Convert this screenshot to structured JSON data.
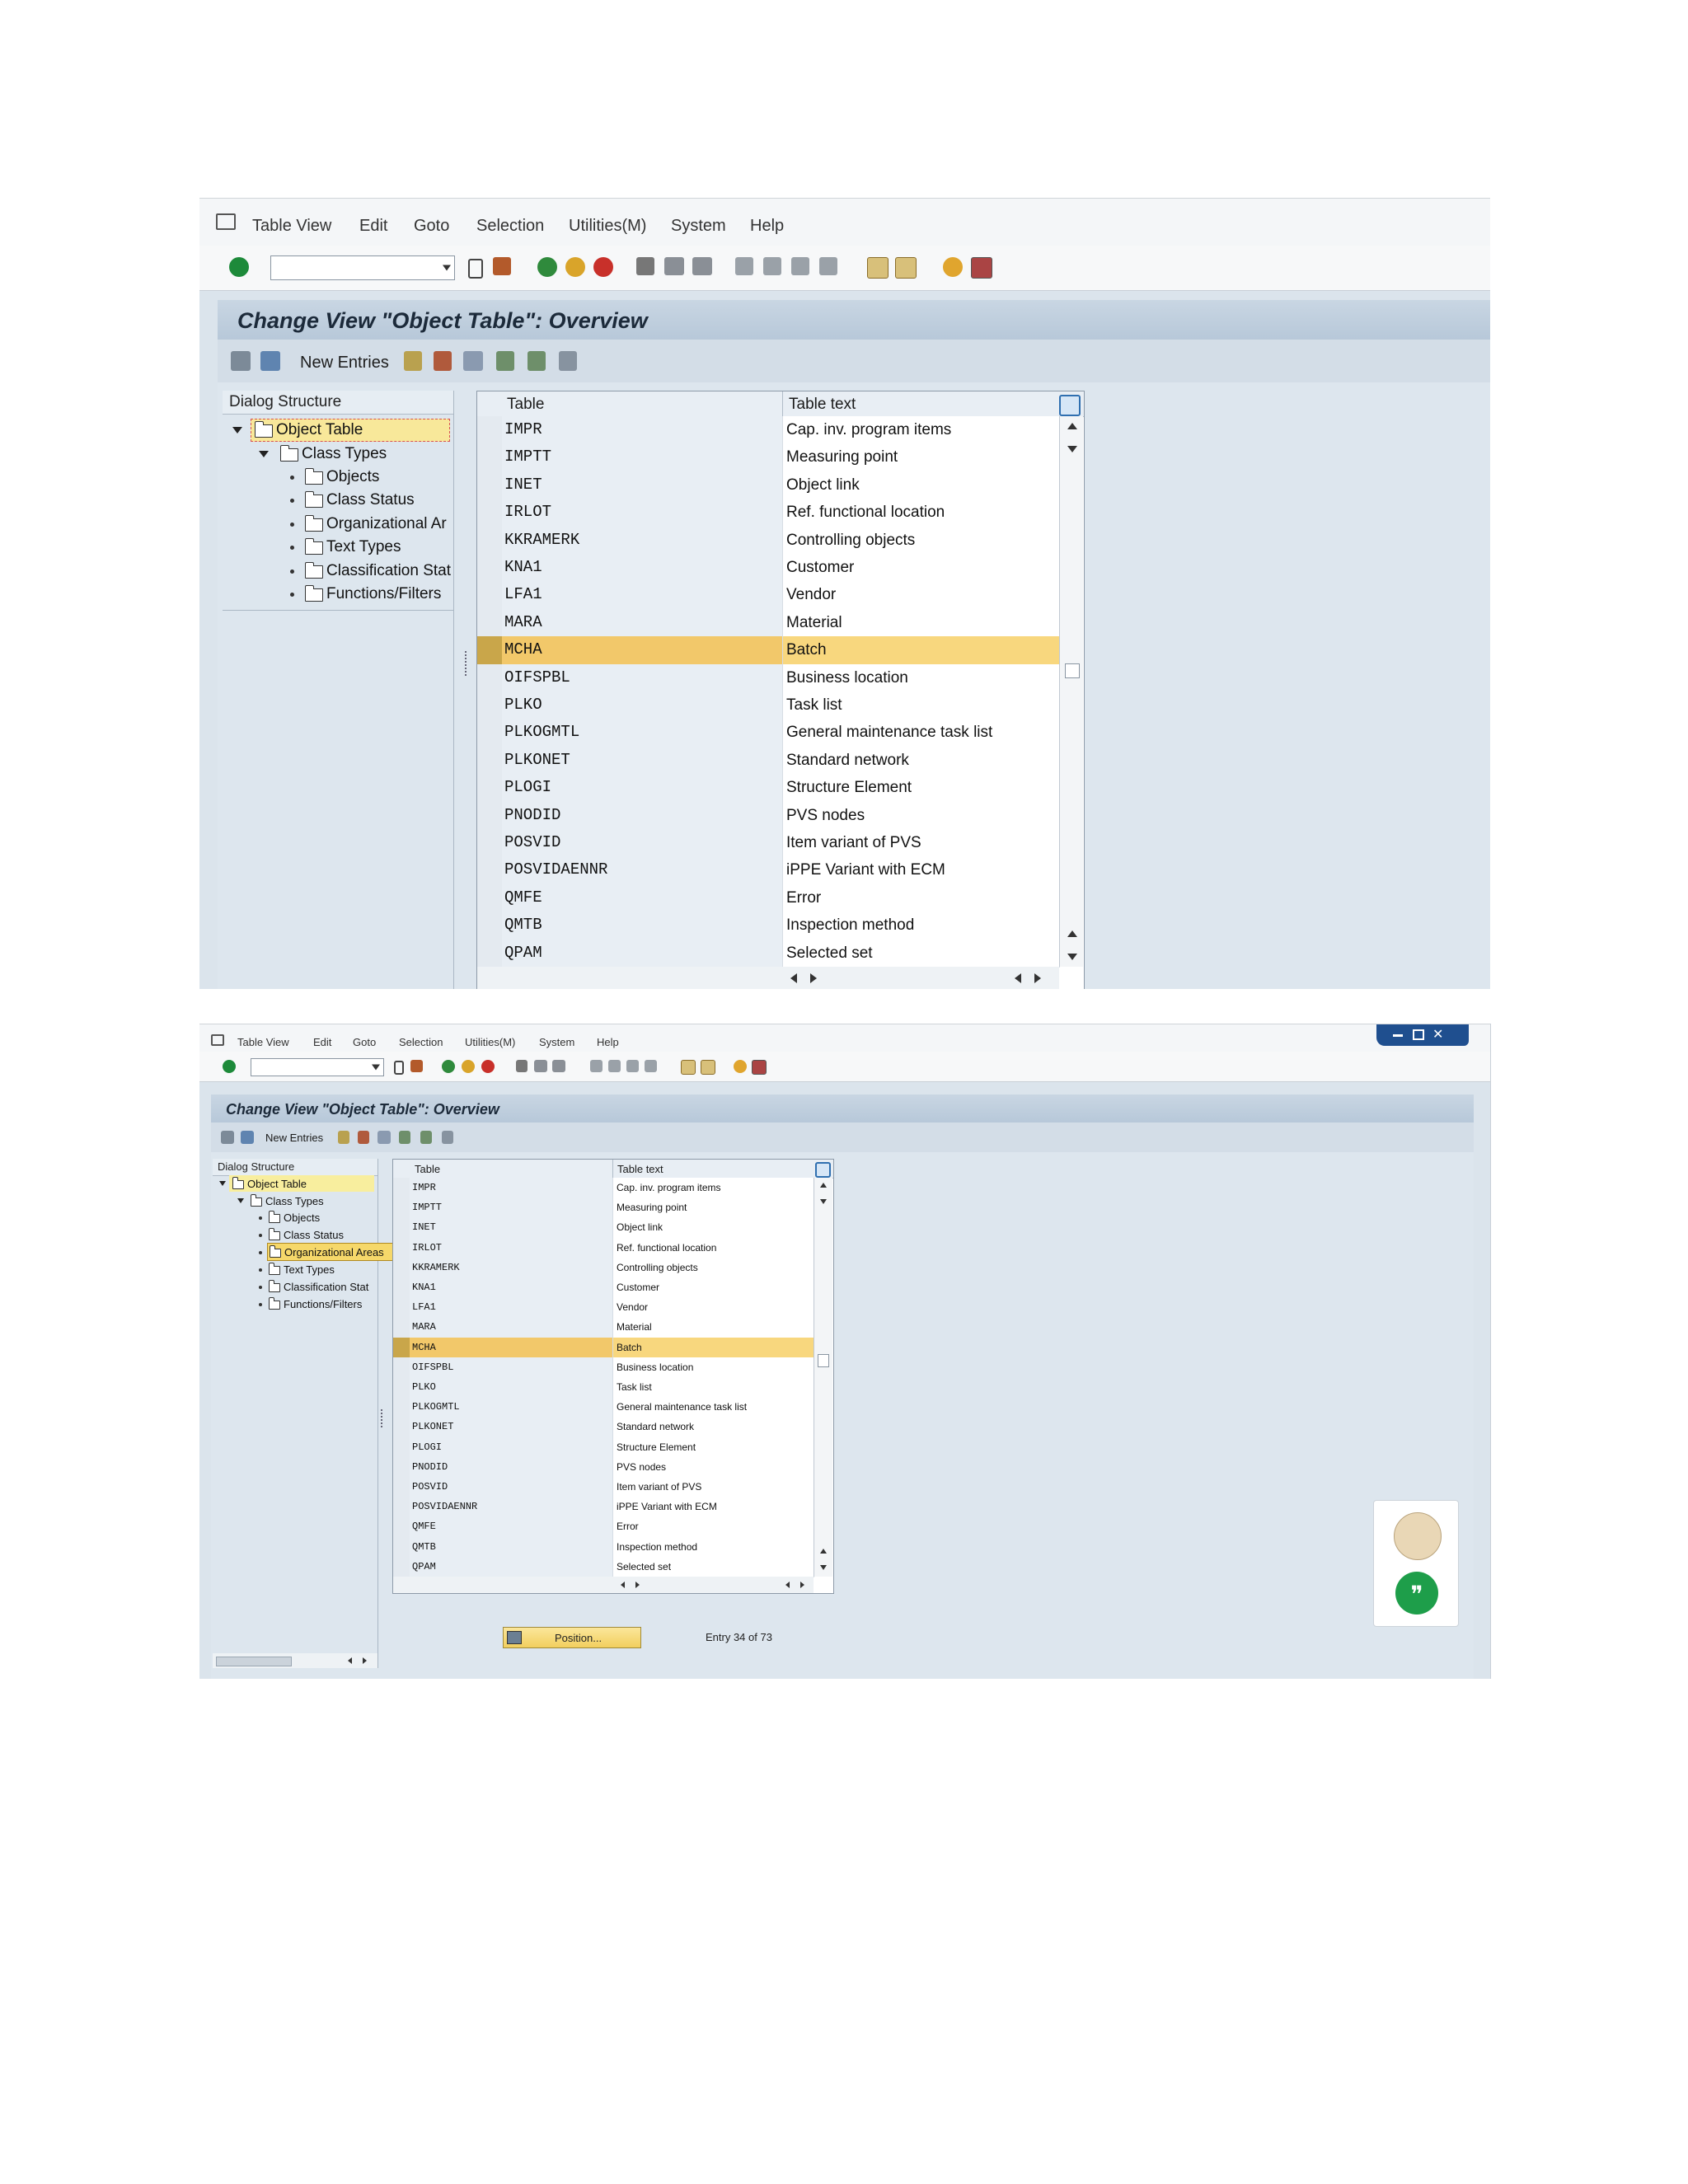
{
  "menu": [
    "Table View",
    "Edit",
    "Goto",
    "Selection",
    "Utilities(M)",
    "System",
    "Help"
  ],
  "page_title": "Change View \"Object Table\": Overview",
  "app_toolbar": {
    "new_entries": "New Entries"
  },
  "dialog_structure": {
    "header": "Dialog Structure",
    "nodes_top": [
      "Object Table",
      "Class Types",
      "Objects",
      "Class Status",
      "Organizational Ar",
      "Text Types",
      "Classification Stat",
      "Functions/Filters"
    ],
    "nodes_bottom": [
      "Object Table",
      "Class Types",
      "Objects",
      "Class Status",
      "Organizational Areas",
      "Text Types",
      "Classification Stat",
      "Functions/Filters"
    ]
  },
  "table": {
    "columns": [
      "Table",
      "Table text"
    ],
    "rows": [
      {
        "key": "IMPR",
        "text": "Cap. inv. program items"
      },
      {
        "key": "IMPTT",
        "text": "Measuring point"
      },
      {
        "key": "INET",
        "text": "Object link"
      },
      {
        "key": "IRLOT",
        "text": "Ref. functional location"
      },
      {
        "key": "KKRAMERK",
        "text": "Controlling objects"
      },
      {
        "key": "KNA1",
        "text": "Customer"
      },
      {
        "key": "LFA1",
        "text": "Vendor"
      },
      {
        "key": "MARA",
        "text": "Material"
      },
      {
        "key": "MCHA",
        "text": "Batch"
      },
      {
        "key": "OIFSPBL",
        "text": "Business location"
      },
      {
        "key": "PLKO",
        "text": "Task list"
      },
      {
        "key": "PLKOGMTL",
        "text": "General maintenance task list"
      },
      {
        "key": "PLKONET",
        "text": "Standard network"
      },
      {
        "key": "PLOGI",
        "text": "Structure Element"
      },
      {
        "key": "PNODID",
        "text": "PVS nodes"
      },
      {
        "key": "POSVID",
        "text": "Item variant of PVS"
      },
      {
        "key": "POSVIDAENNR",
        "text": "iPPE Variant with ECM"
      },
      {
        "key": "QMFE",
        "text": "Error"
      },
      {
        "key": "QMTB",
        "text": "Inspection method"
      },
      {
        "key": "QPAM",
        "text": "Selected set"
      }
    ],
    "highlighted_key": "MCHA"
  },
  "footer": {
    "position_button": "Position...",
    "entry_info": "Entry 34 of 73"
  },
  "colors": {
    "highlight_row": "#f8d77e",
    "title_bar": "#c9d6e3",
    "work_area": "#dde6ee"
  }
}
